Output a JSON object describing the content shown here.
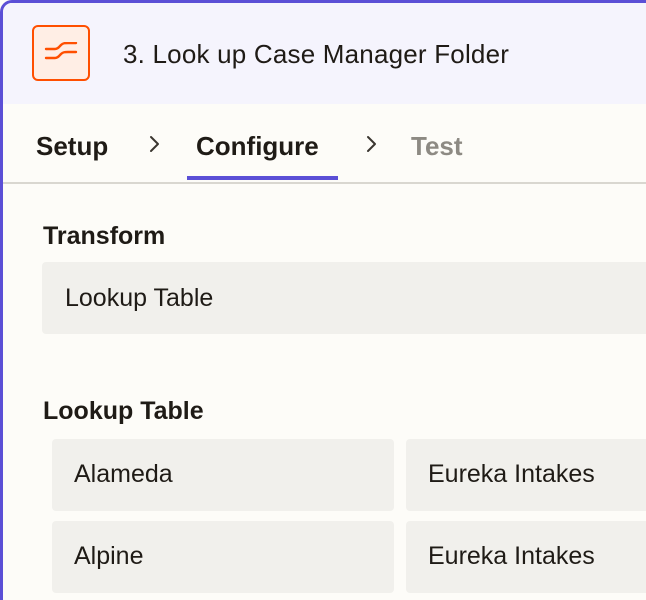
{
  "header": {
    "step_title": "3. Look up Case Manager Folder",
    "icon": "formatter-wave-icon",
    "accent_color": "#ff4f00"
  },
  "tabs": [
    {
      "label": "Setup",
      "state": "default"
    },
    {
      "label": "Configure",
      "state": "active"
    },
    {
      "label": "Test",
      "state": "disabled"
    }
  ],
  "active_tab_color": "#5b4fd6",
  "transform": {
    "label": "Transform",
    "value": "Lookup Table"
  },
  "lookup_table": {
    "label": "Lookup Table",
    "rows": [
      {
        "key": "Alameda",
        "value": "Eureka Intakes"
      },
      {
        "key": "Alpine",
        "value": "Eureka Intakes"
      }
    ]
  }
}
